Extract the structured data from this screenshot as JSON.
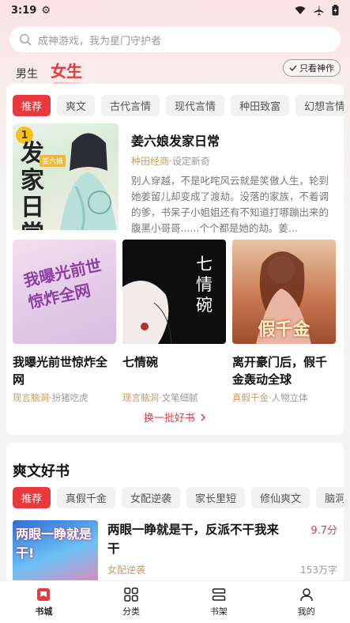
{
  "status": {
    "time": "3:19"
  },
  "search": {
    "placeholder": "成神游戏，我为星门守护者"
  },
  "gender_tabs": [
    {
      "label": "男生"
    },
    {
      "label": "女生"
    }
  ],
  "only_see": "只看神作",
  "categories": [
    "推荐",
    "爽文",
    "古代言情",
    "现代言情",
    "种田致富",
    "幻想言情"
  ],
  "featured": {
    "rank": "1",
    "cover_text": "发家日常",
    "cover_badge": "姜六娘",
    "title": "姜六娘发家日常",
    "tag": "种田经商",
    "meta_sep": "·",
    "meta_extra": "设定新奇",
    "description": "别人穿越，不是叱咤风云就是笑傲人生，轮到她姜留儿却变成了渡劫。没落的家族，不着调的爹，书呆子小姐姐还有不知道打哪蹦出来的腹黑小哥哥......个个都是她的劫。姜..."
  },
  "grid_books": [
    {
      "cover_text": "我曝光前世惊炸全网",
      "title": "我曝光前世惊炸全网",
      "tag": "现言脑洞",
      "extra": "扮猪吃虎"
    },
    {
      "cover_text": "七情碗",
      "title": "七情碗",
      "tag": "现言脑洞",
      "extra": "文笔细腻"
    },
    {
      "cover_text": "假千金",
      "title": "离开豪门后，假千金轰动全球",
      "tag": "真假千金",
      "extra": "人物立体"
    }
  ],
  "refresh_label": "换一批好书",
  "section2": {
    "title": "爽文好书",
    "chips": [
      "推荐",
      "真假千金",
      "女配逆袭",
      "家长里短",
      "修仙爽文",
      "脑洞"
    ],
    "book": {
      "cover_text": "两眼一睁就是干!",
      "title": "两眼一睁就是干，反派不干我来干",
      "score": "9.7分",
      "tag": "女配逆袭",
      "words": "153万字"
    }
  },
  "tabbar": [
    {
      "label": "书城",
      "icon": "bookstore-icon"
    },
    {
      "label": "分类",
      "icon": "category-icon"
    },
    {
      "label": "书架",
      "icon": "bookshelf-icon"
    },
    {
      "label": "我的",
      "icon": "profile-icon"
    }
  ],
  "colors": {
    "accent": "#e8393e",
    "tag": "#c89b5e"
  }
}
